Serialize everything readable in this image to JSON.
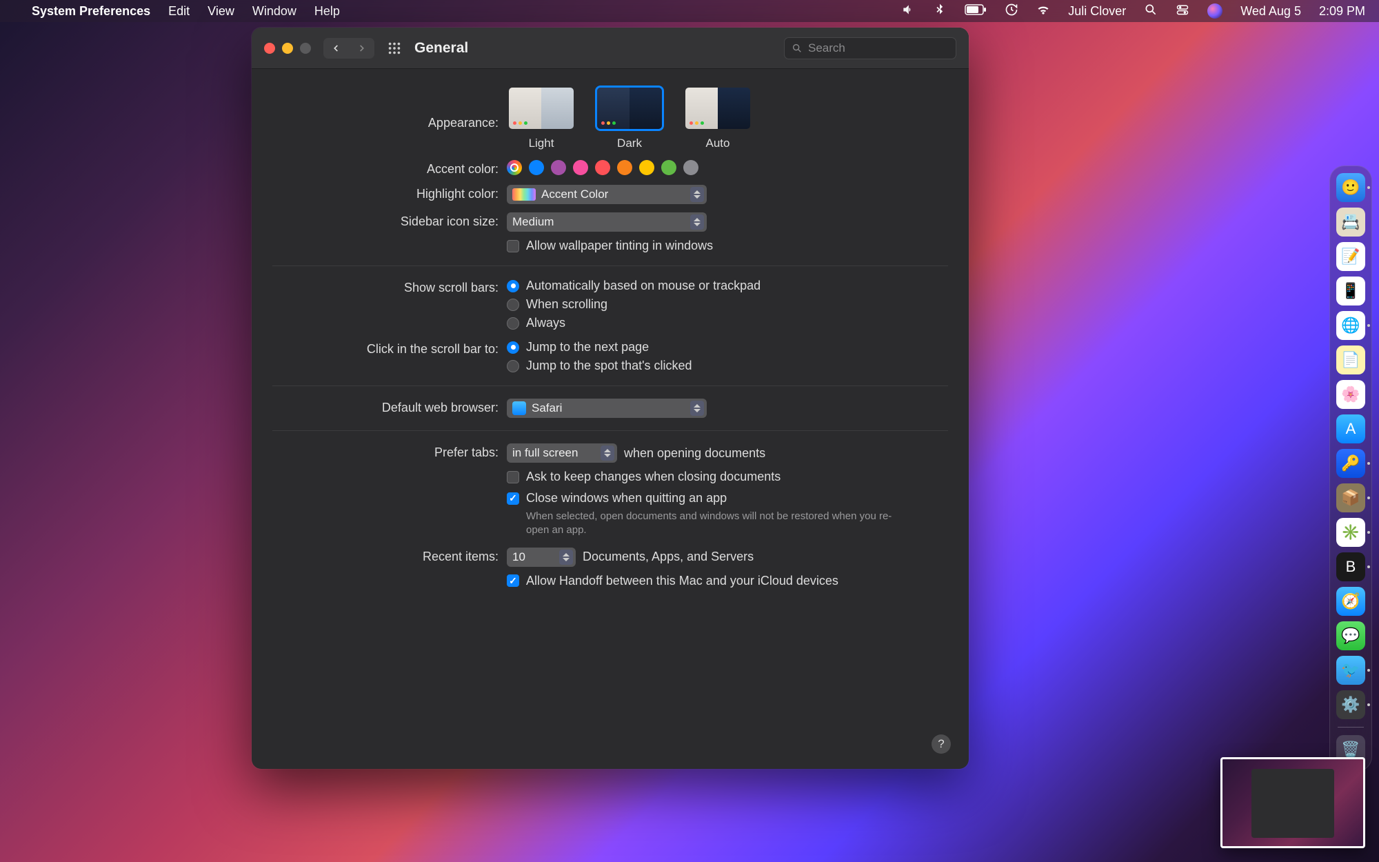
{
  "menubar": {
    "appname": "System Preferences",
    "items": [
      "Edit",
      "View",
      "Window",
      "Help"
    ],
    "user": "Juli Clover",
    "date": "Wed Aug 5",
    "time": "2:09 PM"
  },
  "window": {
    "title": "General",
    "search_placeholder": "Search",
    "appearance": {
      "label": "Appearance:",
      "options": [
        {
          "name": "Light",
          "selected": false
        },
        {
          "name": "Dark",
          "selected": true
        },
        {
          "name": "Auto",
          "selected": false
        }
      ]
    },
    "accent": {
      "label": "Accent color:",
      "colors": [
        "multicolor",
        "#0a84ff",
        "#a550a7",
        "#f74f9e",
        "#ff5257",
        "#f7821b",
        "#ffc600",
        "#62ba46",
        "#8c8c91"
      ],
      "selected_index": 0
    },
    "highlight": {
      "label": "Highlight color:",
      "value": "Accent Color"
    },
    "sidebar_size": {
      "label": "Sidebar icon size:",
      "value": "Medium"
    },
    "wallpaper_tint": {
      "label": "Allow wallpaper tinting in windows",
      "checked": false
    },
    "scrollbars": {
      "label": "Show scroll bars:",
      "options": [
        "Automatically based on mouse or trackpad",
        "When scrolling",
        "Always"
      ],
      "selected_index": 0
    },
    "scrollclick": {
      "label": "Click in the scroll bar to:",
      "options": [
        "Jump to the next page",
        "Jump to the spot that's clicked"
      ],
      "selected_index": 0
    },
    "browser": {
      "label": "Default web browser:",
      "value": "Safari"
    },
    "tabs": {
      "label": "Prefer tabs:",
      "value": "in full screen",
      "suffix": "when opening documents"
    },
    "ask_keep": {
      "label": "Ask to keep changes when closing documents",
      "checked": false
    },
    "close_windows": {
      "label": "Close windows when quitting an app",
      "checked": true,
      "note": "When selected, open documents and windows will not be restored when you re-open an app."
    },
    "recent": {
      "label": "Recent items:",
      "value": "10",
      "suffix": "Documents, Apps, and Servers"
    },
    "handoff": {
      "label": "Allow Handoff between this Mac and your iCloud devices",
      "checked": true
    }
  },
  "dock": {
    "items": [
      {
        "name": "finder",
        "bg": "linear-gradient(#4aa8ff,#1e6fe0)",
        "glyph": "🙂",
        "running": true
      },
      {
        "name": "contacts",
        "bg": "#e6dcc7",
        "glyph": "📇",
        "running": false
      },
      {
        "name": "reminders",
        "bg": "#fff",
        "glyph": "📝",
        "running": false
      },
      {
        "name": "simulator",
        "bg": "#fff",
        "glyph": "📱",
        "running": false
      },
      {
        "name": "chrome",
        "bg": "#fff",
        "glyph": "🌐",
        "running": true
      },
      {
        "name": "notes",
        "bg": "#fff3b0",
        "glyph": "📄",
        "running": false
      },
      {
        "name": "photos",
        "bg": "#fff",
        "glyph": "🌸",
        "running": false
      },
      {
        "name": "appstore",
        "bg": "linear-gradient(#3dbcff,#0a84ff)",
        "glyph": "A",
        "running": false
      },
      {
        "name": "1password",
        "bg": "linear-gradient(#2b6fff,#0a4fe0)",
        "glyph": "🔑",
        "running": true
      },
      {
        "name": "package",
        "bg": "#8a7a5a",
        "glyph": "📦",
        "running": true
      },
      {
        "name": "slack",
        "bg": "#fff",
        "glyph": "✳️",
        "running": true
      },
      {
        "name": "bold-app",
        "bg": "#1a1a1a",
        "glyph": "B",
        "running": true
      },
      {
        "name": "safari",
        "bg": "linear-gradient(#4ac0ff,#0a84ff)",
        "glyph": "🧭",
        "running": false
      },
      {
        "name": "messages",
        "bg": "linear-gradient(#5fe06a,#2bbf3a)",
        "glyph": "💬",
        "running": false
      },
      {
        "name": "tweetbot",
        "bg": "linear-gradient(#4ac0ff,#2b8fe0)",
        "glyph": "🐦",
        "running": true
      },
      {
        "name": "sysprefs",
        "bg": "#3b3b3d",
        "glyph": "⚙️",
        "running": true
      }
    ],
    "trash": {
      "name": "trash",
      "glyph": "🗑️"
    }
  }
}
